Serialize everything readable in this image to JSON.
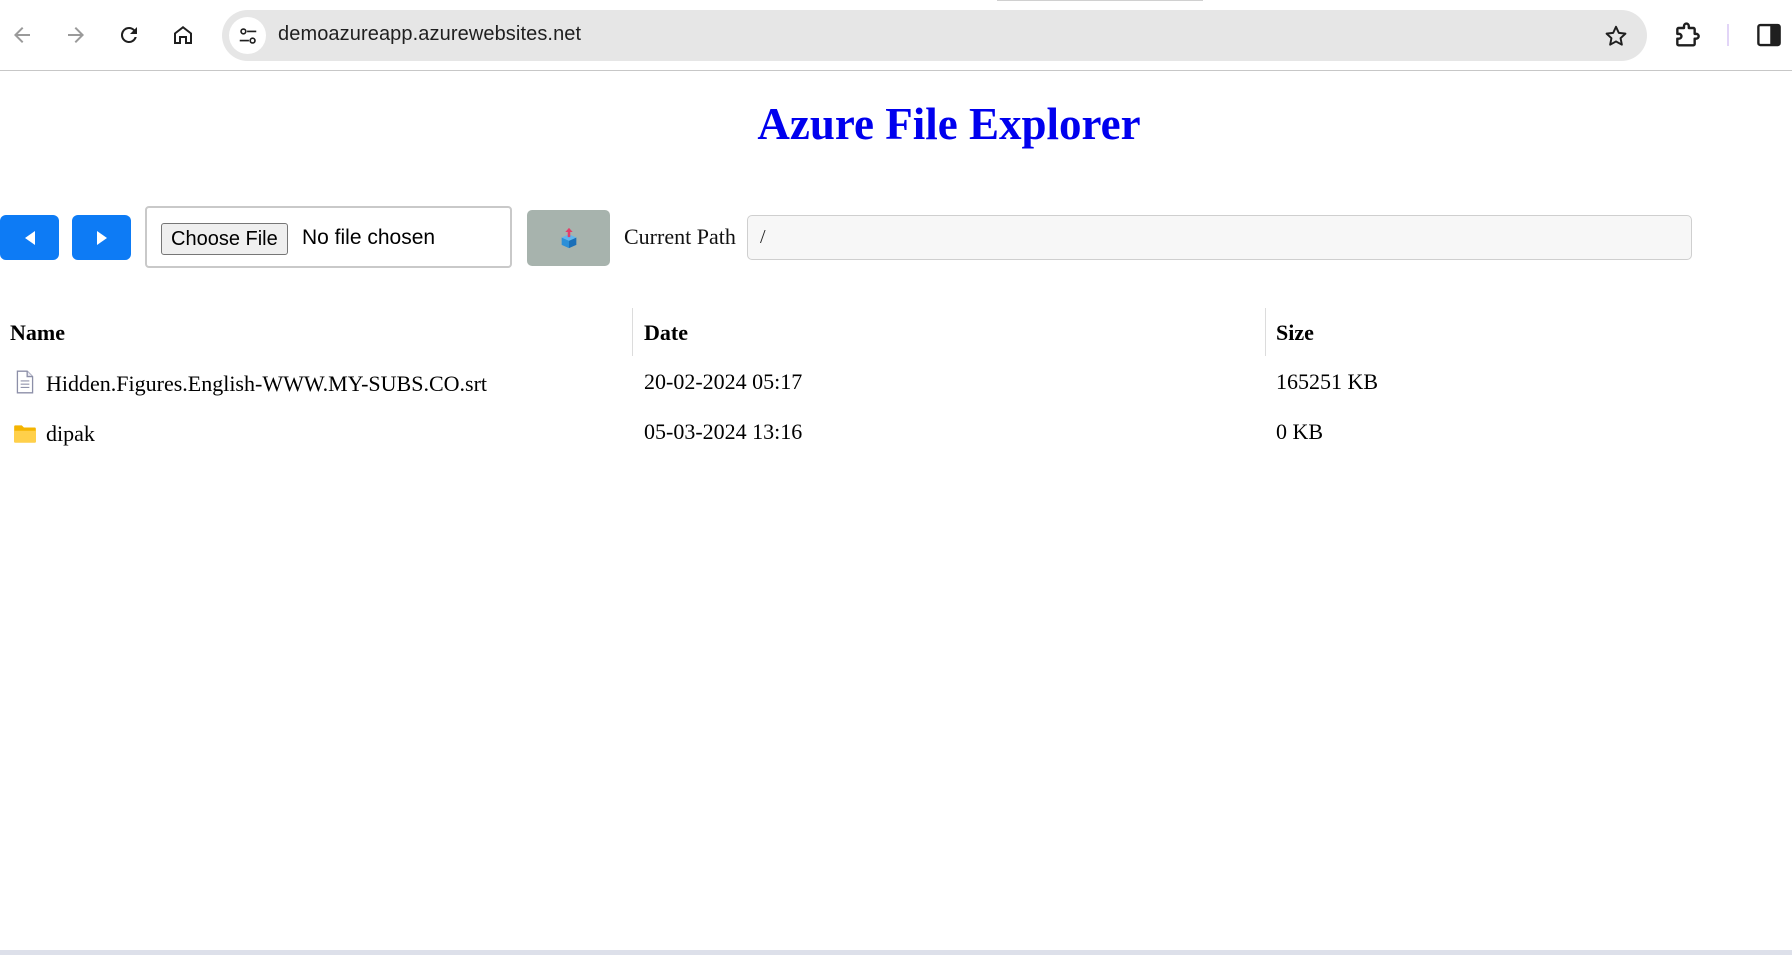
{
  "browser": {
    "url": "demoazureapp.azurewebsites.net",
    "icons": {
      "back": "arrow-left-icon",
      "forward": "arrow-right-icon",
      "reload": "reload-icon",
      "home": "home-icon",
      "site_info": "tune-icon",
      "bookmark": "star-icon",
      "extensions": "puzzle-icon",
      "side_panel": "side-panel-icon"
    }
  },
  "page": {
    "title": "Azure File Explorer",
    "title_color": "#0000ee",
    "toolbar": {
      "back_button": "left-triangle-icon",
      "forward_button": "right-triangle-icon",
      "button_color": "#0d7bf5",
      "choose_file_label": "Choose File",
      "no_file_text": "No file chosen",
      "upload_button": "upload-icon",
      "current_path_label": "Current Path",
      "current_path_value": "/"
    },
    "table": {
      "headers": {
        "name": "Name",
        "date": "Date",
        "size": "Size"
      },
      "rows": [
        {
          "icon": "file-icon",
          "name": "Hidden.Figures.English-WWW.MY-SUBS.CO.srt",
          "date": "20-02-2024 05:17",
          "size": "165251 KB"
        },
        {
          "icon": "folder-icon",
          "name": "dipak",
          "date": "05-03-2024 13:16",
          "size": "0 KB"
        }
      ]
    }
  }
}
